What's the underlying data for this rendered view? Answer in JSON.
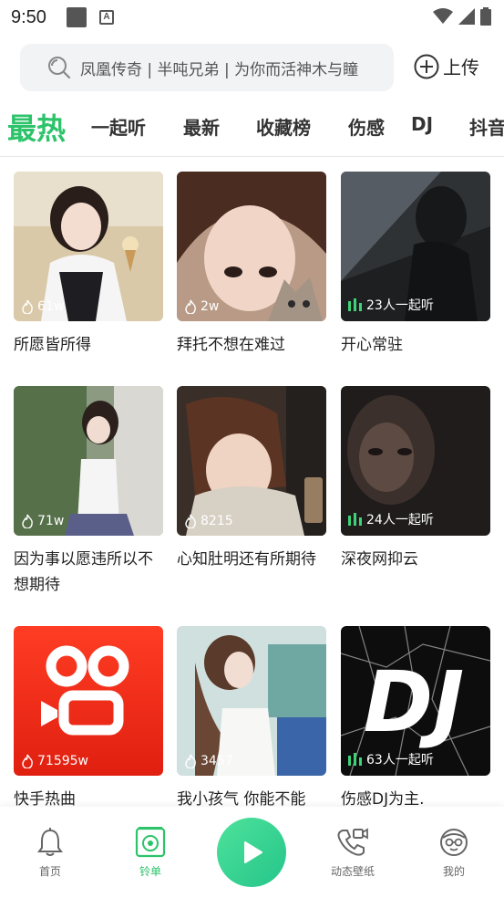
{
  "status_bar": {
    "time": "9:50"
  },
  "search": {
    "placeholder": "凤凰传奇 | 半吨兄弟 | 为你而活神木与瞳"
  },
  "upload": {
    "label": "上传"
  },
  "tabs": [
    {
      "label": "最热",
      "active": true
    },
    {
      "label": "一起听"
    },
    {
      "label": "最新"
    },
    {
      "label": "收藏榜"
    },
    {
      "label": "伤感"
    },
    {
      "label": "DJ"
    },
    {
      "label": "抖音"
    }
  ],
  "cards": [
    {
      "title": "所愿皆所得",
      "stat": "61w",
      "stat_type": "hot"
    },
    {
      "title": "拜托不想在难过",
      "stat": "2w",
      "stat_type": "hot"
    },
    {
      "title": "开心常驻",
      "stat": "23人一起听",
      "stat_type": "listen"
    },
    {
      "title": "因为事以愿违所以不想期待",
      "stat": "71w",
      "stat_type": "hot"
    },
    {
      "title": "心知肚明还有所期待",
      "stat": "8215",
      "stat_type": "hot"
    },
    {
      "title": "深夜网抑云",
      "stat": "24人一起听",
      "stat_type": "listen"
    },
    {
      "title": "快手热曲",
      "stat": "71595w",
      "stat_type": "hot"
    },
    {
      "title": "我小孩气 你能不能",
      "stat": "3457",
      "stat_type": "hot"
    },
    {
      "title": "伤感DJ为主.",
      "stat": "63人一起听",
      "stat_type": "listen"
    }
  ],
  "dj_logo_text": "DJ",
  "bottom_nav": {
    "home": "首页",
    "ringtone": "铃单",
    "wallpaper": "动态壁纸",
    "mine": "我的"
  },
  "colors": {
    "accent": "#2dc36a",
    "kuaishou_red": "#f32a1a"
  }
}
